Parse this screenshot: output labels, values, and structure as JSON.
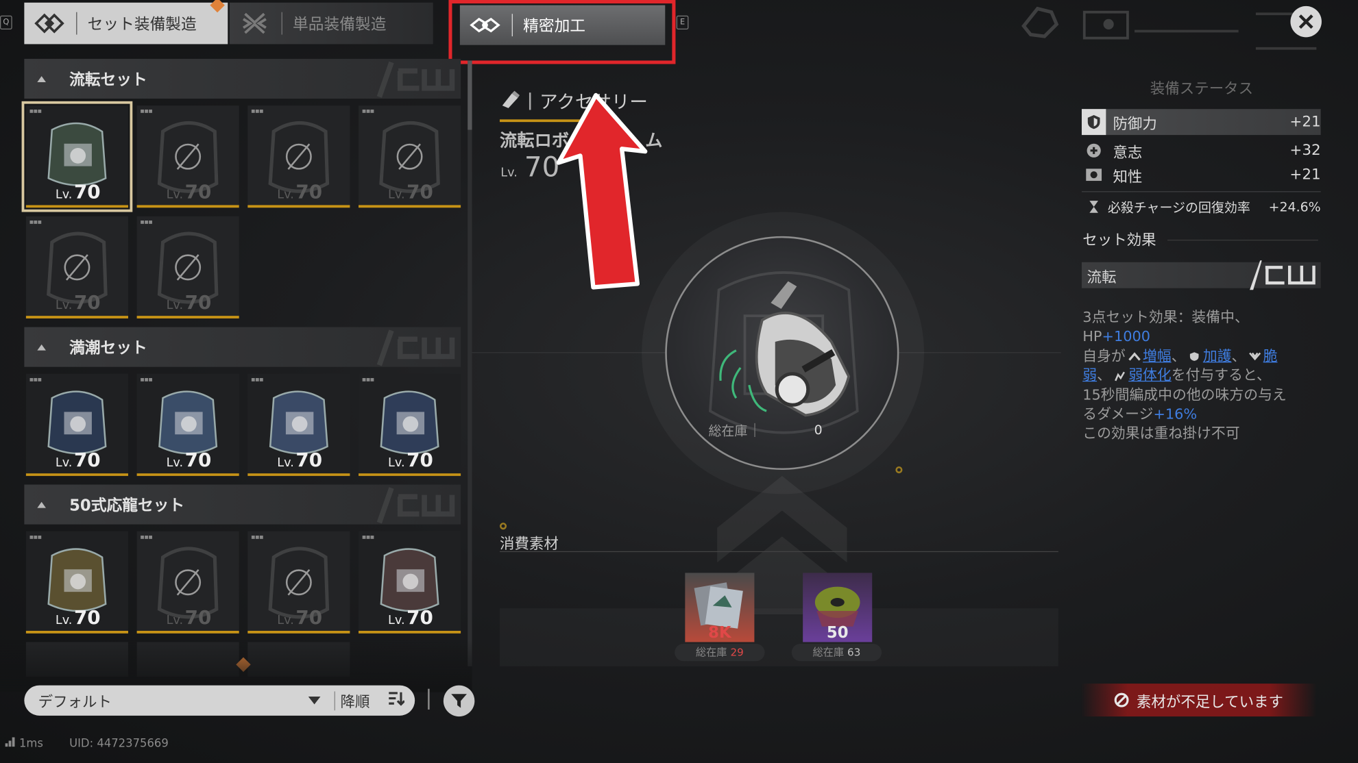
{
  "tabs": {
    "q_key": "Q",
    "e_key": "E",
    "set_label": "セット装備製造",
    "single_label": "単品装備製造",
    "precision_label": "精密加工"
  },
  "groups": [
    {
      "title": "流転セット",
      "tiles": [
        {
          "level": "70",
          "locked": false,
          "selected": true
        },
        {
          "level": "70",
          "locked": true
        },
        {
          "level": "70",
          "locked": true
        },
        {
          "level": "70",
          "locked": true
        },
        {
          "level": "70",
          "locked": true
        },
        {
          "level": "70",
          "locked": true
        }
      ]
    },
    {
      "title": "満潮セット",
      "tiles": [
        {
          "level": "70",
          "locked": false
        },
        {
          "level": "70",
          "locked": false
        },
        {
          "level": "70",
          "locked": false
        },
        {
          "level": "70",
          "locked": false
        }
      ]
    },
    {
      "title": "50式応龍セット",
      "tiles": [
        {
          "level": "70",
          "locked": false
        },
        {
          "level": "70",
          "locked": true
        },
        {
          "level": "70",
          "locked": true
        },
        {
          "level": "70",
          "locked": false
        }
      ]
    }
  ],
  "lv_prefix": "Lv.",
  "sort": {
    "default_label": "デフォルト",
    "order_label": "降順"
  },
  "footer": {
    "ping": "1ms",
    "uid": "UID: 4472375669"
  },
  "item": {
    "category": "アクセサリー",
    "name_visible_start": "流転ロボ",
    "name_visible_end": "ム",
    "level_prefix": "Lv.",
    "level": "70",
    "stock_label": "総在庫",
    "stock_value": "0"
  },
  "materials": {
    "title": "消費素材",
    "items": [
      {
        "count": "8K",
        "count_color": "#e04848",
        "stock_label": "総在庫",
        "stock": "29",
        "stock_red": true
      },
      {
        "count": "50",
        "count_color": "#e8e8e8",
        "stock_label": "総在庫",
        "stock": "63",
        "stock_red": false
      }
    ]
  },
  "stats": {
    "title": "装備ステータス",
    "rows": [
      {
        "icon": "shield-icon",
        "label": "防御力",
        "value": "+21"
      },
      {
        "icon": "will-icon",
        "label": "意志",
        "value": "+32"
      },
      {
        "icon": "intellect-icon",
        "label": "知性",
        "value": "+21"
      }
    ],
    "extra": {
      "icon": "hourglass-icon",
      "label": "必殺チャージの回復効率",
      "value": "+24.6%"
    }
  },
  "set_effect": {
    "title": "セット効果",
    "set_name": "流転",
    "line1": "3点セット効果：装備中、",
    "hp_prefix": "HP",
    "hp_value": "+1000",
    "line3_prefix": "自身が",
    "buff1": "増幅",
    "buff2": "加護",
    "buff3_part1": "脆",
    "buff3_part2": "弱",
    "buff4": "弱体化",
    "line4_suffix": "を付与すると、",
    "line5": "15秒間編成中の他の味方の与え",
    "line6_prefix": "るダメージ",
    "dmg_value": "+16%",
    "line7": "この効果は重ね掛け不可"
  },
  "warning": "素材が不足しています",
  "colors": {
    "accent_gold": "#c79316",
    "highlight_red": "#e1262b",
    "link_blue": "#3f7de0",
    "warning_red": "#961919"
  }
}
